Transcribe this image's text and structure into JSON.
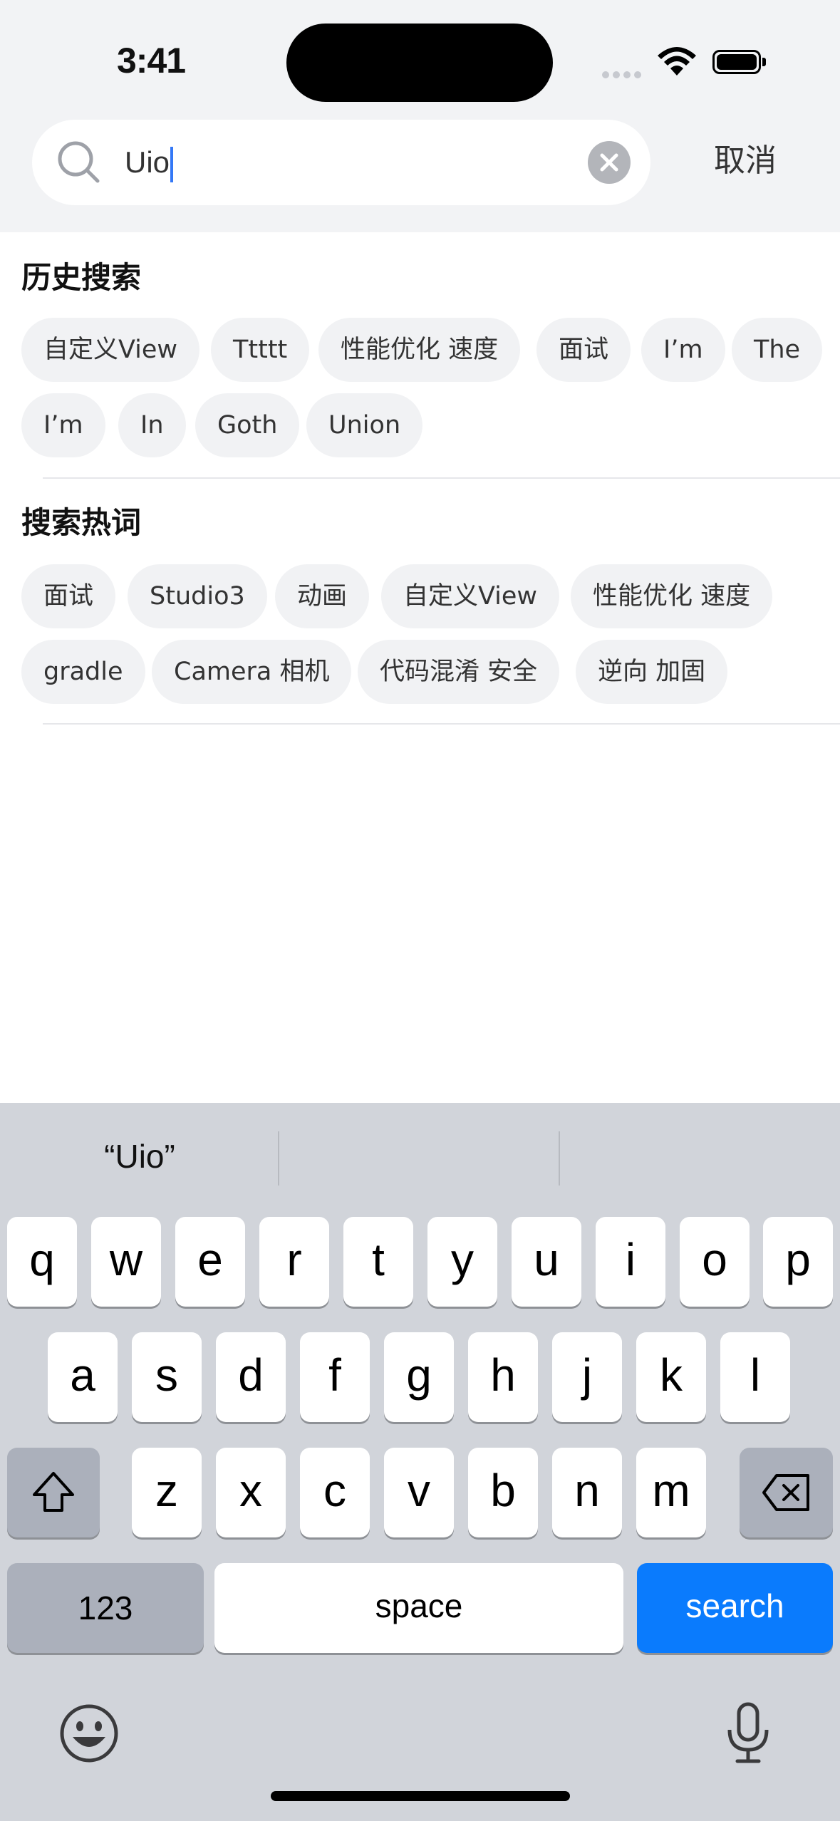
{
  "status_bar": {
    "time": "3:41"
  },
  "search": {
    "value": "Uio",
    "cancel_label": "取消"
  },
  "history": {
    "title": "历史搜索",
    "tags": [
      "自定义View",
      "Ttttt",
      "性能优化 速度",
      "面试",
      "I’m",
      "The",
      "I’m",
      "In",
      "Goth",
      "Union"
    ]
  },
  "hot": {
    "title": "搜索热词",
    "tags": [
      "面试",
      "Studio3",
      "动画",
      "自定义View",
      "性能优化 速度",
      "gradle",
      "Camera 相机",
      "代码混淆 安全",
      "逆向 加固"
    ]
  },
  "keyboard": {
    "suggestions": [
      "“Uio”",
      "",
      ""
    ],
    "row1": [
      "q",
      "w",
      "e",
      "r",
      "t",
      "y",
      "u",
      "i",
      "o",
      "p"
    ],
    "row2": [
      "a",
      "s",
      "d",
      "f",
      "g",
      "h",
      "j",
      "k",
      "l"
    ],
    "row3": [
      "z",
      "x",
      "c",
      "v",
      "b",
      "n",
      "m"
    ],
    "numbers_label": "123",
    "space_label": "space",
    "search_label": "search"
  }
}
